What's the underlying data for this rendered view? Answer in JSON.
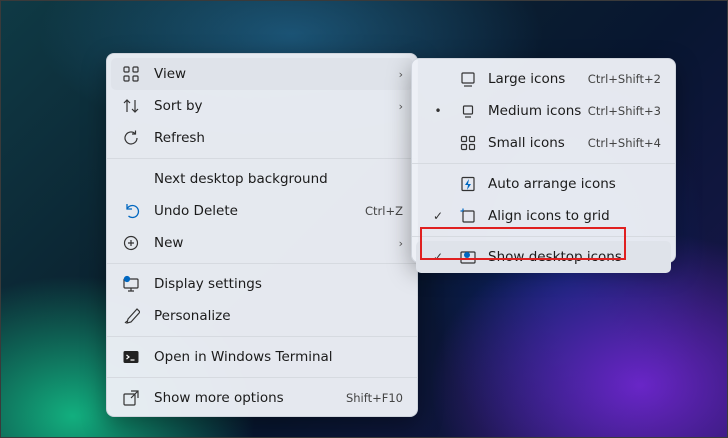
{
  "main_menu": {
    "view_label": "View",
    "sort_label": "Sort by",
    "refresh_label": "Refresh",
    "next_bg_label": "Next desktop background",
    "undo_label": "Undo Delete",
    "undo_shortcut": "Ctrl+Z",
    "new_label": "New",
    "display_label": "Display settings",
    "personalize_label": "Personalize",
    "terminal_label": "Open in Windows Terminal",
    "more_label": "Show more options",
    "more_shortcut": "Shift+F10",
    "chevron": "›"
  },
  "view_submenu": {
    "large_label": "Large icons",
    "large_shortcut": "Ctrl+Shift+2",
    "medium_label": "Medium icons",
    "medium_shortcut": "Ctrl+Shift+3",
    "medium_mark": "•",
    "small_label": "Small icons",
    "small_shortcut": "Ctrl+Shift+4",
    "auto_label": "Auto arrange icons",
    "align_label": "Align icons to grid",
    "align_mark": "✓",
    "show_label": "Show desktop icons",
    "show_mark": "✓"
  },
  "colors": {
    "highlight_outline": "#e02020",
    "accent": "#0067c0"
  }
}
